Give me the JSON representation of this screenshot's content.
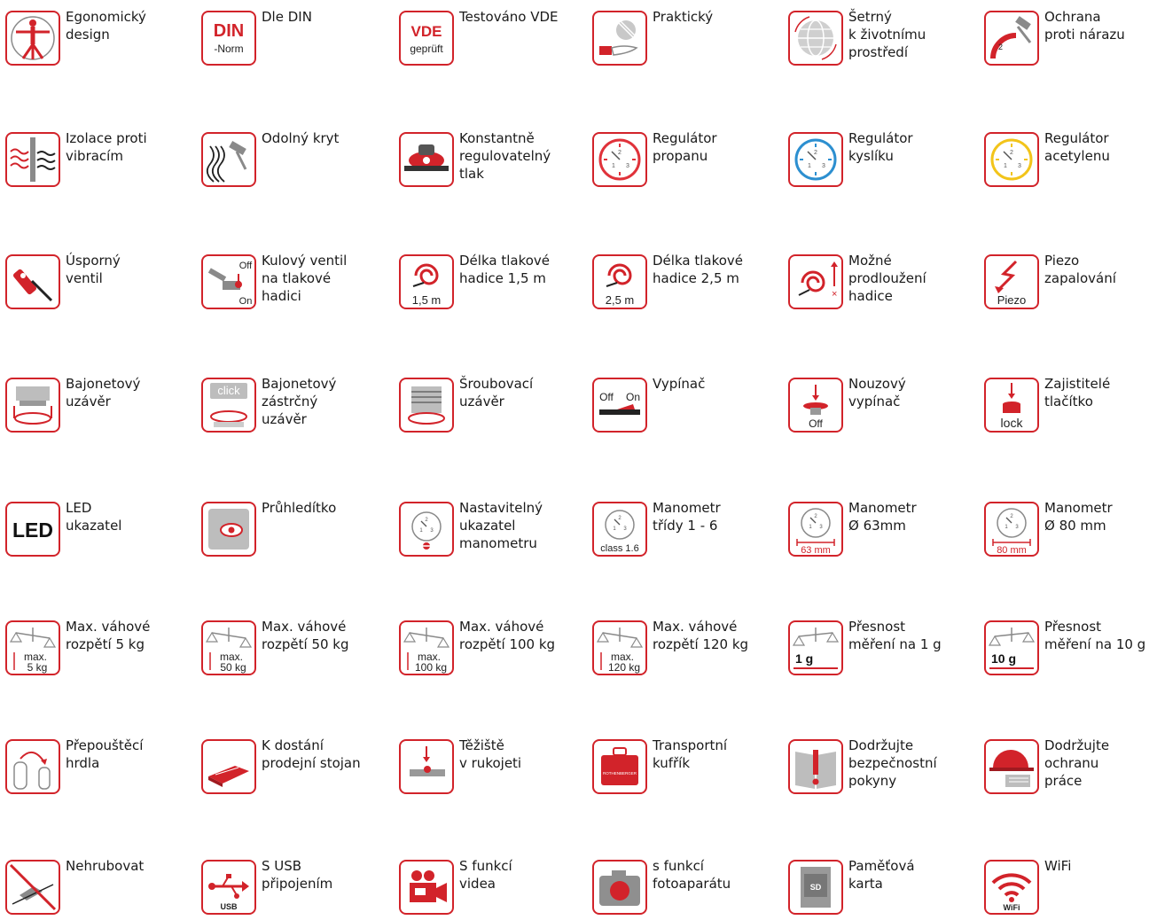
{
  "accent_color": "#d2232a",
  "features": [
    {
      "label": "Egonomický\ndesign",
      "icon": "human-figure-icon"
    },
    {
      "label": "Dle DIN",
      "icon": "din-norm-icon",
      "t1": "DIN",
      "t2": "-Norm"
    },
    {
      "label": "Testováno VDE",
      "icon": "vde-tested-icon",
      "t1": "VDE",
      "t2": "geprüft"
    },
    {
      "label": "Praktický",
      "icon": "hand-icon"
    },
    {
      "label": "Šetrný\nk životnímu\nprostředí",
      "icon": "globe-icon"
    },
    {
      "label": "Ochrana\nproti nárazu",
      "icon": "hammer-impact-icon"
    },
    {
      "label": "Izolace proti\nvibracím",
      "icon": "vibration-icon"
    },
    {
      "label": "Odolný kryt",
      "icon": "hammer-icon"
    },
    {
      "label": "Konstantně\nregulovatelný\ntlak",
      "icon": "pressure-regulator-icon"
    },
    {
      "label": "Regulátor\npropanu",
      "icon": "gauge-red-icon"
    },
    {
      "label": "Regulátor\nkyslíku",
      "icon": "gauge-blue-icon"
    },
    {
      "label": "Regulátor\nacetylenu",
      "icon": "gauge-yellow-icon"
    },
    {
      "label": "Úsporný\nventil",
      "icon": "torch-icon"
    },
    {
      "label": "Kulový ventil\nna tlakové\nhadici",
      "icon": "ball-valve-icon",
      "t1": "Off",
      "t2": "On"
    },
    {
      "label": "Délka tlakové\nhadice 1,5 m",
      "icon": "hose-coil-icon",
      "t1": "1,5 m"
    },
    {
      "label": "Délka tlakové\nhadice 2,5 m",
      "icon": "hose-coil-icon",
      "t1": "2,5 m"
    },
    {
      "label": "Možné\nprodloužení\nhadice",
      "icon": "hose-extension-icon"
    },
    {
      "label": "Piezo\nzapalování",
      "icon": "piezo-spark-icon",
      "t1": "Piezo"
    },
    {
      "label": "Bajonetový\nuzávěr",
      "icon": "bayonet-icon"
    },
    {
      "label": "Bajonetový\nzástrčný\nuzávěr",
      "icon": "bayonet-click-icon",
      "t1": "click"
    },
    {
      "label": "Šroubovací\nuzávěr",
      "icon": "screw-cap-icon"
    },
    {
      "label": "Vypínač",
      "icon": "switch-icon",
      "t1": "Off",
      "t2": "On"
    },
    {
      "label": "Nouzový\nvypínač",
      "icon": "emergency-stop-icon",
      "t1": "Off"
    },
    {
      "label": "Zajistitelé\ntlačítko",
      "icon": "lock-button-icon",
      "t1": "lock"
    },
    {
      "label": "LED\nukazatel",
      "icon": "led-icon",
      "t1": "LED"
    },
    {
      "label": "Průhledítko",
      "icon": "sight-glass-icon"
    },
    {
      "label": "Nastavitelný\nukazatel\nmanometru",
      "icon": "gauge-adjust-icon"
    },
    {
      "label": "Manometr\ntřídy 1 - 6",
      "icon": "gauge-class-icon",
      "t1": "class 1.6"
    },
    {
      "label": "Manometr\nØ 63mm",
      "icon": "gauge-size-icon",
      "t1": "63 mm"
    },
    {
      "label": "Manometr\nØ 80 mm",
      "icon": "gauge-size-icon",
      "t1": "80 mm"
    },
    {
      "label": "Max. váhové\nrozpětí 5 kg",
      "icon": "scale-icon",
      "t1": "max.",
      "t2": "5 kg"
    },
    {
      "label": "Max. váhové\nrozpětí 50 kg",
      "icon": "scale-icon",
      "t1": "max.",
      "t2": "50 kg"
    },
    {
      "label": "Max. váhové\nrozpětí 100 kg",
      "icon": "scale-icon",
      "t1": "max.",
      "t2": "100 kg"
    },
    {
      "label": "Max. váhové\nrozpětí  120 kg",
      "icon": "scale-icon",
      "t1": "max.",
      "t2": "120 kg"
    },
    {
      "label": "Přesnost\nměření na 1 g",
      "icon": "scale-precision-icon",
      "t1": "1 g"
    },
    {
      "label": "Přesnost\nměření na 10 g",
      "icon": "scale-precision-icon",
      "t1": "10 g"
    },
    {
      "label": "Přepouštěcí\nhrdla",
      "icon": "transfer-cylinders-icon"
    },
    {
      "label": "K dostání\nprodejní stojan",
      "icon": "display-stand-icon"
    },
    {
      "label": "Těžiště\nv rukojeti",
      "icon": "center-of-gravity-icon"
    },
    {
      "label": "Transportní\nkufřík",
      "icon": "carry-case-icon",
      "t1": "ROTHENBERGER"
    },
    {
      "label": "Dodržujte\nbezpečnostní\npokyny",
      "icon": "safety-manual-icon"
    },
    {
      "label": "Dodržujte\nochranu\npráce",
      "icon": "helmet-glove-icon"
    },
    {
      "label": "Nehrubovat",
      "icon": "no-deburring-icon"
    },
    {
      "label": "S USB\npřipojením",
      "icon": "usb-icon",
      "t1": "USB"
    },
    {
      "label": "S funkcí\nvidea",
      "icon": "video-camera-icon"
    },
    {
      "label": "s funkcí\nfotoaparátu",
      "icon": "photo-camera-icon"
    },
    {
      "label": "Paměťová\nkarta",
      "icon": "sd-card-icon",
      "t1": "SD"
    },
    {
      "label": "WiFi",
      "icon": "wifi-icon",
      "t1": "WiFi"
    }
  ]
}
